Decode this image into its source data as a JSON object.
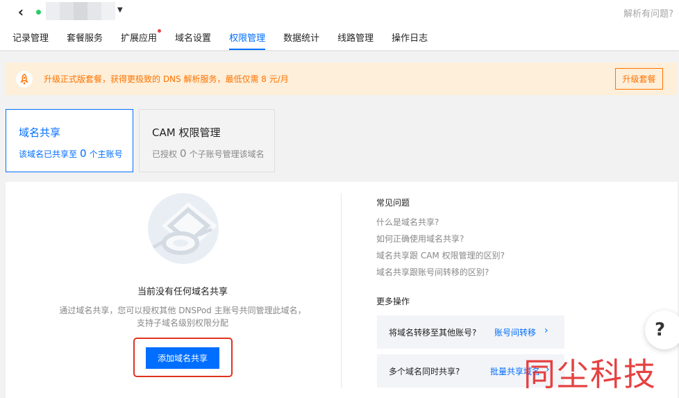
{
  "header": {
    "back_icon": "chevron-left-icon",
    "status_color": "#29cc6a",
    "help_link": "解析有问题?",
    "tabs": [
      {
        "label": "记录管理",
        "active": false,
        "dot": false
      },
      {
        "label": "套餐服务",
        "active": false,
        "dot": false
      },
      {
        "label": "扩展应用",
        "active": false,
        "dot": true
      },
      {
        "label": "域名设置",
        "active": false,
        "dot": false
      },
      {
        "label": "权限管理",
        "active": true,
        "dot": false
      },
      {
        "label": "数据统计",
        "active": false,
        "dot": false
      },
      {
        "label": "线路管理",
        "active": false,
        "dot": false
      },
      {
        "label": "操作日志",
        "active": false,
        "dot": false
      }
    ]
  },
  "banner": {
    "icon": "rocket-icon",
    "text": "升级正式版套餐，获得更极致的 DNS 解析服务，最低仅需 8 元/月",
    "button": "升级套餐"
  },
  "cards": {
    "share": {
      "title": "域名共享",
      "desc_prefix": "该域名已共享至",
      "count": "0",
      "desc_suffix": "个主账号"
    },
    "cam": {
      "title": "CAM 权限管理",
      "desc_prefix": "已授权",
      "count": "0",
      "desc_suffix": "个子账号管理该域名"
    }
  },
  "empty": {
    "title": "当前没有任何域名共享",
    "desc_line1": "通过域名共享，您可以授权其他 DNSPod 主账号共同管理此域名，",
    "desc_line2": "支持子域名级别权限分配",
    "button": "添加域名共享"
  },
  "faq": {
    "title": "常见问题",
    "items": [
      "什么是域名共享?",
      "如何正确使用域名共享?",
      "域名共享跟 CAM 权限管理的区别?",
      "域名共享跟账号间转移的区别?"
    ]
  },
  "more": {
    "title": "更多操作",
    "ops": [
      {
        "text": "将域名转移至其他账号?",
        "link": "账号间转移"
      },
      {
        "text": "多个域名同时共享?",
        "link": "批量共享域名"
      }
    ]
  },
  "float_help": "?",
  "watermark": "同尘科技",
  "colors": {
    "accent": "#006eff",
    "warning": "#ff7200",
    "highlight_frame": "#e0321f"
  }
}
